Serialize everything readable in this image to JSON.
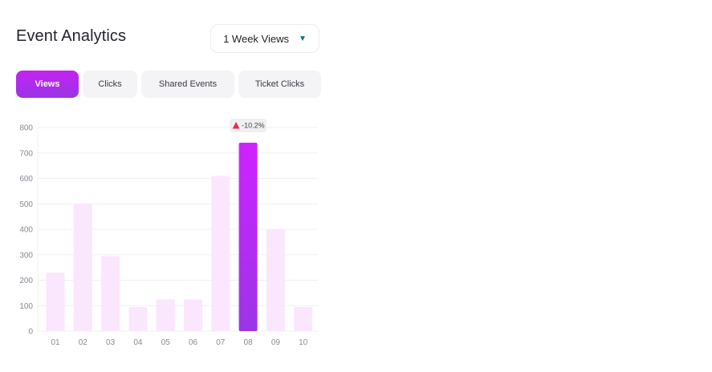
{
  "header": {
    "title": "Event Analytics",
    "period_label": "1 Week Views",
    "period_caret_icon": "caret-down-icon"
  },
  "tabs": [
    {
      "label": "Views",
      "active": true
    },
    {
      "label": "Clicks",
      "active": false
    },
    {
      "label": "Shared Events",
      "active": false
    },
    {
      "label": "Ticket Clicks",
      "active": false
    }
  ],
  "colors": {
    "bar_default": "#fae6fd",
    "bar_highlight_top": "#cf22ff",
    "bar_highlight_bottom": "#9b35e6",
    "grid": "#f0f0f2",
    "warning_icon": "#e2314a"
  },
  "chart_data": {
    "type": "bar",
    "categories": [
      "01",
      "02",
      "03",
      "04",
      "05",
      "06",
      "07",
      "08",
      "09",
      "10"
    ],
    "values": [
      230,
      500,
      295,
      95,
      125,
      125,
      610,
      740,
      400,
      95
    ],
    "ylim": [
      0,
      800
    ],
    "yticks": [
      0,
      100,
      200,
      300,
      400,
      500,
      600,
      700,
      800
    ],
    "grid": true,
    "highlight_index": 7,
    "annotation": {
      "index": 7,
      "text": "-10.2%",
      "icon": "warning-triangle-icon"
    }
  }
}
